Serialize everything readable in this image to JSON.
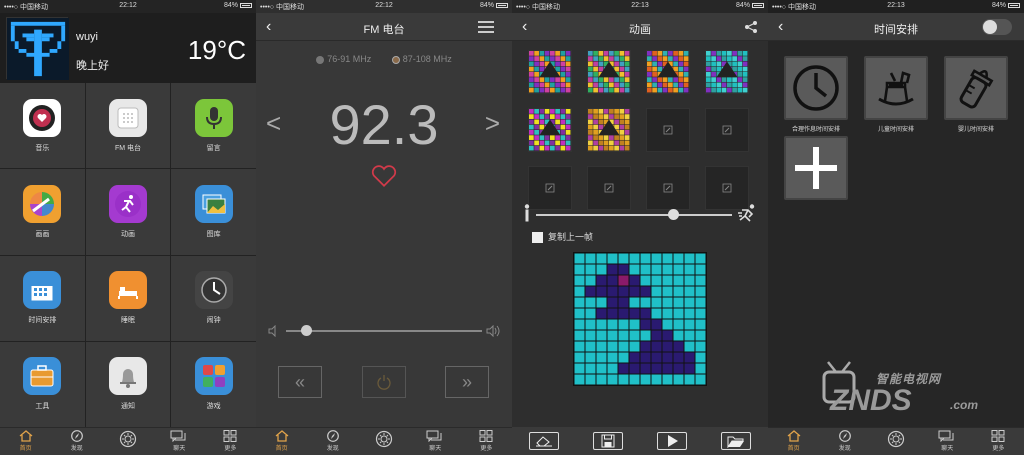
{
  "status_bars": [
    {
      "carrier": "••••○ 中国移动 ",
      "time": "22:12",
      "battery": "84%"
    },
    {
      "carrier": "••••○ 中国移动 ",
      "time": "22:12",
      "battery": "84%"
    },
    {
      "carrier": "••••○ 中国移动 ",
      "time": "22:13",
      "battery": "84%"
    },
    {
      "carrier": "••••○ 中国移动 ",
      "time": "22:13",
      "battery": "84%"
    }
  ],
  "home": {
    "username": "wuyi",
    "greeting": "晚上好",
    "temperature": "19°C",
    "apps": [
      {
        "label": "音乐",
        "icon": "music-icon",
        "color": "#ffffff"
      },
      {
        "label": "FM 电台",
        "icon": "radio-icon",
        "color": "#e8e8e8"
      },
      {
        "label": "留言",
        "icon": "microphone-icon",
        "color": "#7cc63a"
      },
      {
        "label": "画画",
        "icon": "palette-icon",
        "color": "#f0a030"
      },
      {
        "label": "动画",
        "icon": "running-man-icon",
        "color": "#a43ad0"
      },
      {
        "label": "图库",
        "icon": "gallery-icon",
        "color": "#3a8fd8"
      },
      {
        "label": "时间安排",
        "icon": "calendar-icon",
        "color": "#3a8fd8"
      },
      {
        "label": "睡眠",
        "icon": "bed-icon",
        "color": "#f09030"
      },
      {
        "label": "闹钟",
        "icon": "clock-icon",
        "color": "#444444"
      },
      {
        "label": "工具",
        "icon": "toolbox-icon",
        "color": "#3a8fd8"
      },
      {
        "label": "通知",
        "icon": "bell-icon",
        "color": "#e8e8e8"
      },
      {
        "label": "游戏",
        "icon": "game-icon",
        "color": "#3a8fd8"
      }
    ]
  },
  "tabbar": {
    "items": [
      {
        "label": "首页",
        "icon": "home-icon"
      },
      {
        "label": "发现",
        "icon": "compass-icon"
      },
      {
        "label": "",
        "icon": "light-icon"
      },
      {
        "label": "聊天",
        "icon": "chat-icon"
      },
      {
        "label": "更多",
        "icon": "grid-icon"
      }
    ],
    "accent": "#e1a34a"
  },
  "fm": {
    "title": "FM 电台",
    "band1": "76-91 MHz",
    "band2": "87-108 MHz",
    "frequency": "92.3",
    "prev": "<",
    "next": ">",
    "volume": 0.1
  },
  "animation": {
    "title": "动画",
    "copy_prev_frame": "复制上一帧",
    "speed": 0.7,
    "frame_count": 6,
    "empty_slots": 6
  },
  "schedule": {
    "title": "时间安排",
    "items": [
      {
        "label": "合理作息时间安排",
        "icon": "clock-icon"
      },
      {
        "label": "儿童时间安排",
        "icon": "rocking-horse-icon"
      },
      {
        "label": "婴儿时间安排",
        "icon": "baby-bottle-icon"
      },
      {
        "label": "",
        "icon": "add-icon"
      }
    ]
  },
  "watermark": {
    "brand": "ZNDS",
    "dotcom": ".com",
    "tagline": "智能电视网"
  }
}
